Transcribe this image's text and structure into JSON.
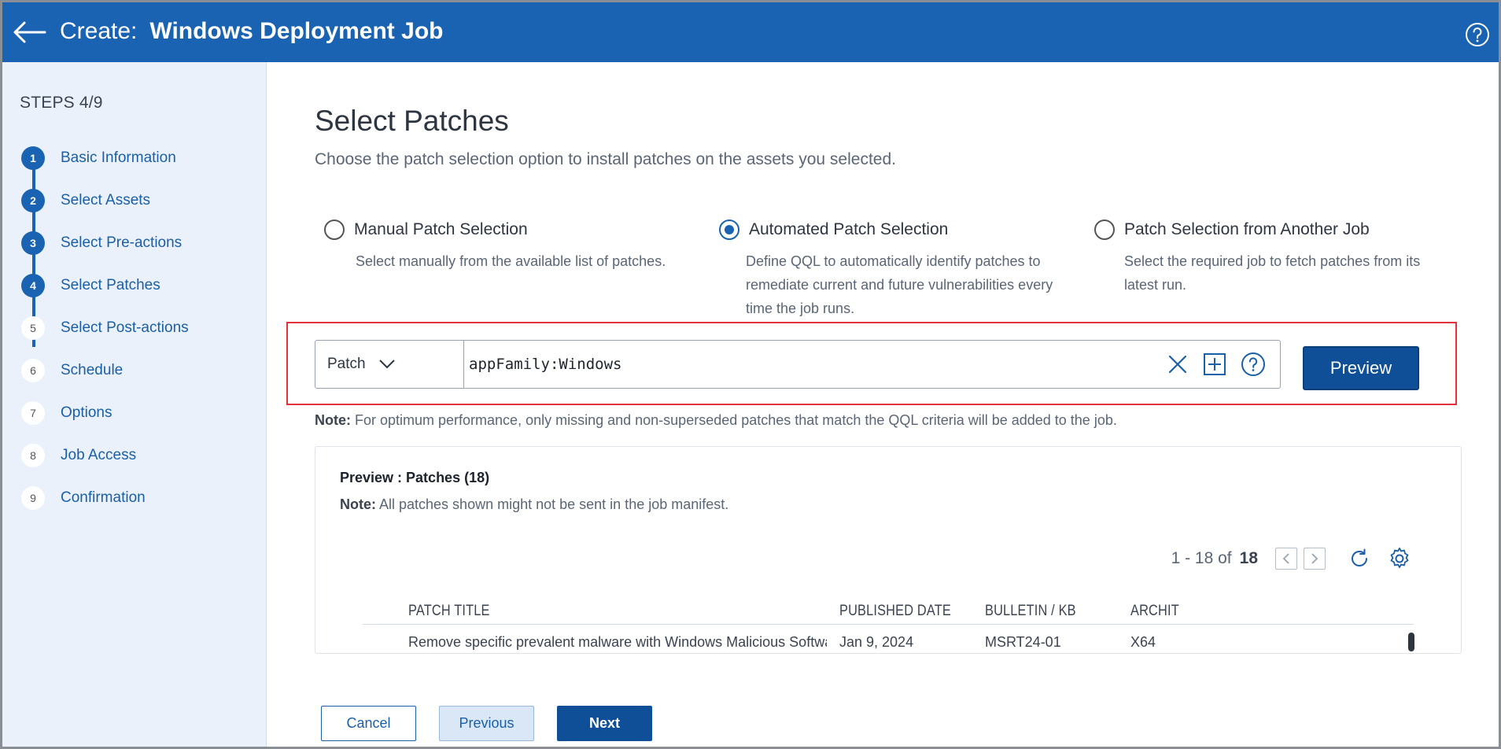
{
  "header": {
    "title_prefix": "Create:",
    "title_name": "Windows Deployment Job"
  },
  "sidebar": {
    "steps_count": "STEPS 4/9",
    "steps": [
      {
        "num": "1",
        "label": "Basic Information"
      },
      {
        "num": "2",
        "label": "Select Assets"
      },
      {
        "num": "3",
        "label": "Select Pre-actions"
      },
      {
        "num": "4",
        "label": "Select Patches"
      },
      {
        "num": "5",
        "label": "Select Post-actions"
      },
      {
        "num": "6",
        "label": "Schedule"
      },
      {
        "num": "7",
        "label": "Options"
      },
      {
        "num": "8",
        "label": "Job Access"
      },
      {
        "num": "9",
        "label": "Confirmation"
      }
    ]
  },
  "main": {
    "title": "Select Patches",
    "subtitle": "Choose the patch selection option to install patches on the assets you selected.",
    "options": [
      {
        "label": "Manual Patch Selection",
        "desc": "Select manually from the available list of patches.",
        "selected": false
      },
      {
        "label": "Automated Patch Selection",
        "desc_lines": [
          "Define QQL to automatically identify patches to",
          "remediate current and future vulnerabilities every",
          "time the job runs."
        ],
        "selected": true
      },
      {
        "label": "Patch Selection from Another Job",
        "desc_lines": [
          "Select the required job to fetch patches from its",
          "latest run."
        ],
        "selected": false
      }
    ],
    "qql": {
      "scope": "Patch",
      "query": "appFamily:Windows",
      "preview_label": "Preview"
    },
    "note_label": "Note:",
    "note_text": " For optimum performance, only missing and non-superseded patches that match the QQL criteria will be added to the job."
  },
  "preview": {
    "title": "Preview : Patches (18)",
    "note_label": "Note:",
    "note_text": " All patches shown might not be sent in the job manifest.",
    "pager_range": "1 - 18 of",
    "pager_total": "18",
    "columns": [
      "PATCH TITLE",
      "PUBLISHED DATE",
      "BULLETIN / KB",
      "ARCHIT"
    ],
    "rows": [
      [
        "Remove specific prevalent malware with Windows Malicious Software Re...",
        "Jan 9, 2024",
        "MSRT24-01",
        "X64"
      ]
    ]
  },
  "footer": {
    "cancel": "Cancel",
    "previous": "Previous",
    "next": "Next"
  },
  "colors": {
    "brand": "#1a63b3",
    "primary_button": "#0e4f98",
    "highlight_border": "#e2333d",
    "sidebar_bg": "#eaf1fa"
  }
}
